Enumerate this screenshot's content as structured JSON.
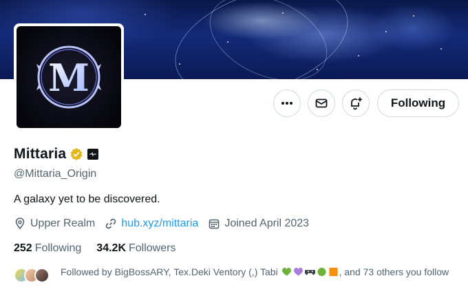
{
  "profile": {
    "display_name": "Mittaria",
    "handle": "@Mittaria_Origin",
    "bio": "A galaxy yet to be discovered.",
    "avatar_letter": "M"
  },
  "meta": {
    "location": "Upper Realm",
    "website": "hub.xyz/mittaria",
    "joined": "Joined April 2023"
  },
  "stats": {
    "following_count": "252",
    "following_label": "Following",
    "followers_count": "34.2K",
    "followers_label": "Followers"
  },
  "actions": {
    "follow_label": "Following",
    "more_icon": "more-icon",
    "message_icon": "mail-icon",
    "notify_icon": "bell-plus-icon"
  },
  "followed_by": {
    "prefix": "Followed by BigBossARY, Tex.Deki  Ventory  (,) Tabi ",
    "suffix": ", and 73 others you follow"
  },
  "colors": {
    "accent_link": "#1d9bf0",
    "verified_gold": "#e2b719",
    "text_primary": "#0f1419",
    "text_secondary": "#536471",
    "border": "#cfd9de"
  }
}
